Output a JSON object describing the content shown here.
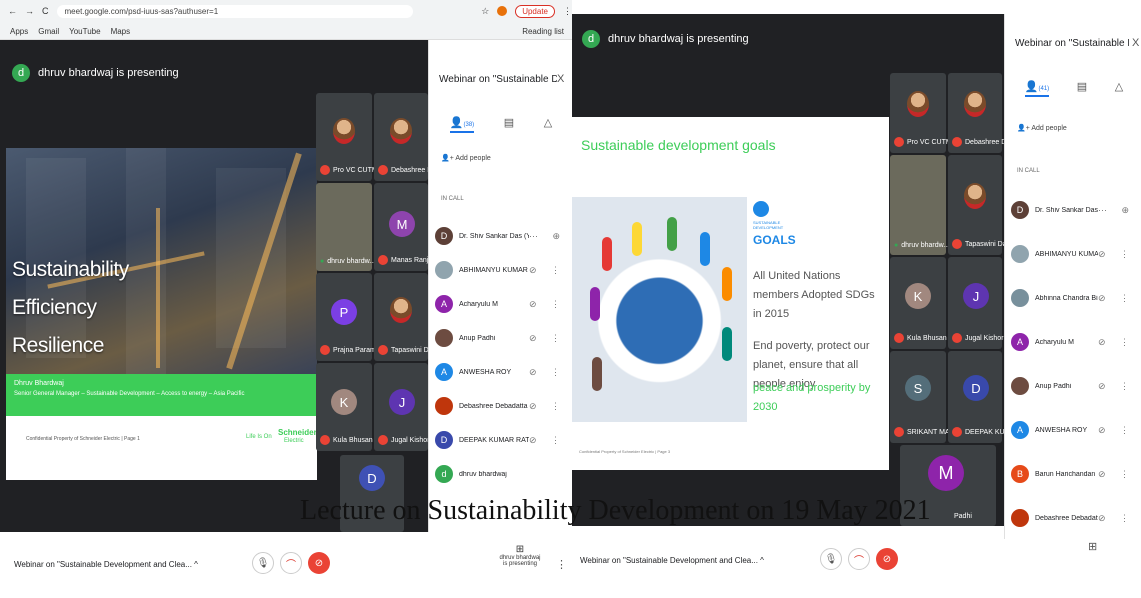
{
  "browser": {
    "url": "meet.google.com/psd-iuus-sas?authuser=1",
    "update_label": "Update",
    "bookmarks": [
      "Apps",
      "Gmail",
      "YouTube",
      "Maps"
    ],
    "reading_list": "Reading list"
  },
  "left": {
    "presenting": "dhruv bhardwaj is presenting",
    "presenter_initial": "d",
    "slide": {
      "line1": "Sustainability",
      "line2": "Efficiency",
      "line3": "Resilience",
      "name": "Dhruv Bhardwaj",
      "role": "Senior General Manager – Sustainable Development – Access to energy – Asia Pacific",
      "footer_left": "Confidential Property of Schneider Electric | Page 1",
      "logo_tag": "Life Is On",
      "logo": "Schneider",
      "logo_sub": "Electric"
    },
    "tiles": [
      {
        "name": "Pro VC CUTM"
      },
      {
        "name": "Debashree D..."
      },
      {
        "name": "dhruv bhardw..."
      },
      {
        "name": "Manas Ranja...",
        "initial": "M"
      },
      {
        "name": "Prajna Param...",
        "initial": "P"
      },
      {
        "name": "Tapaswini Da..."
      },
      {
        "name": "Kula Bhusan ...",
        "initial": "K"
      },
      {
        "name": "Jugal Kishor",
        "initial": "J"
      },
      {
        "initial": "D"
      }
    ],
    "panel": {
      "title": "Webinar on \"Sustainable Develop...",
      "close": "X",
      "count": "(38)",
      "add_people": "Add people",
      "in_call": "IN CALL",
      "people": [
        {
          "name": "Dr. Shiv Sankar Das (You)",
          "initial": "D"
        },
        {
          "name": "ABHIMANYU KUMAR PA..."
        },
        {
          "name": "Acharyulu M",
          "initial": "A"
        },
        {
          "name": "Anup Padhi"
        },
        {
          "name": "ANWESHA ROY",
          "initial": "A"
        },
        {
          "name": "Debashree Debadatta B..."
        },
        {
          "name": "DEEPAK KUMAR RATH",
          "initial": "D"
        },
        {
          "name": "dhruv bhardwaj",
          "initial": "d"
        }
      ]
    },
    "bottom": {
      "meeting_title": "Webinar on \"Sustainable Development and Clea...",
      "presenting_line1": "dhruv bhardwaj",
      "presenting_line2": "is presenting"
    }
  },
  "right": {
    "presenting": "dhruv bhardwaj is presenting",
    "presenter_initial": "d",
    "slide": {
      "title": "Sustainable development goals",
      "sdg_small": "SUSTAINABLE DEVELOPMENT",
      "sdg_big": "GOALS",
      "text1": "All United Nations members Adopted SDGs in 2015",
      "text2": "End poverty, protect our planet, ensure that all people enjoy",
      "text3": "peace and prosperity by 2030",
      "footer": "Confidential Property of Schneider Electric | Page 3"
    },
    "tiles": [
      {
        "name": "Pro VC CUTM"
      },
      {
        "name": "Debashree D..."
      },
      {
        "name": "dhruv bhardw..."
      },
      {
        "name": "Tapaswini Da..."
      },
      {
        "name": "Kula Bhusan ...",
        "initial": "K"
      },
      {
        "name": "Jugal Kishor",
        "initial": "J"
      },
      {
        "name": "SRIKANT MA...",
        "initial": "S"
      },
      {
        "name": "DEEPAK KUM...",
        "initial": "D"
      },
      {
        "name": "Padhi",
        "initial": "M"
      }
    ],
    "panel": {
      "title": "Webinar on \"Sustainable Develop...",
      "close": "X",
      "count": "(41)",
      "add_people": "Add people",
      "in_call": "IN CALL",
      "people": [
        {
          "name": "Dr. Shiv Sankar Das (You)",
          "initial": "D"
        },
        {
          "name": "ABHIMANYU KUMAR PA..."
        },
        {
          "name": "Abhinna Chandra Biswal"
        },
        {
          "name": "Acharyulu M",
          "initial": "A"
        },
        {
          "name": "Anup Padhi"
        },
        {
          "name": "ANWESHA ROY",
          "initial": "A"
        },
        {
          "name": "Barun Harichandan",
          "initial": "B"
        },
        {
          "name": "Debashree Debadatta B..."
        }
      ]
    },
    "bottom": {
      "meeting_title": "Webinar on \"Sustainable Development and Clea..."
    }
  },
  "caption": "Lecture on Sustainability Development on 19 May 2021",
  "colors": {
    "meet_dark": "#202124",
    "schneider_green": "#3dcd58",
    "end_call_red": "#ea4335",
    "accent_blue": "#1a73e8"
  }
}
